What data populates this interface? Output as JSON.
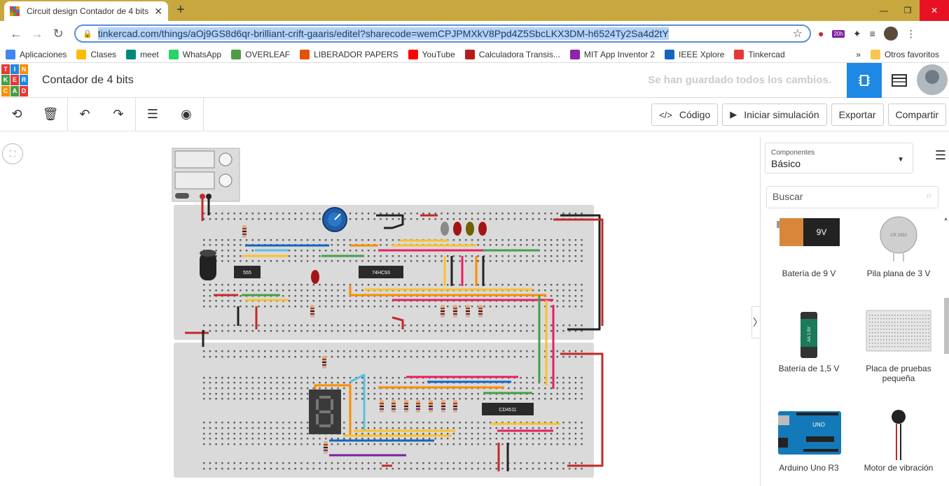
{
  "browser": {
    "tab_title": "Circuit design Contador de 4 bits",
    "url": "tinkercad.com/things/aOj9GS8d6qr-brilliant-crift-gaaris/editel?sharecode=wemCPJPMXkV8Ppd4Z5SbcLKX3DM-h6524Ty2Sa4d2tY",
    "ext_badge": "20h",
    "bookmarks": [
      {
        "label": "Aplicaciones",
        "color": "#4285f4"
      },
      {
        "label": "Clases",
        "color": "#fbbc04"
      },
      {
        "label": "meet",
        "color": "#00897b"
      },
      {
        "label": "WhatsApp",
        "color": "#25d366"
      },
      {
        "label": "OVERLEAF",
        "color": "#4f9c45"
      },
      {
        "label": "LIBERADOR PAPERS",
        "color": "#e65100"
      },
      {
        "label": "YouTube",
        "color": "#ff0000"
      },
      {
        "label": "Calculadora Transis...",
        "color": "#b71c1c"
      },
      {
        "label": "MIT App Inventor 2",
        "color": "#8e24aa"
      },
      {
        "label": "IEEE Xplore",
        "color": "#1565c0"
      },
      {
        "label": "Tinkercad",
        "color": "#e53935"
      }
    ],
    "bookmarks_more": "»",
    "other_favorites": "Otros favoritos"
  },
  "app": {
    "logo_letters": [
      "T",
      "I",
      "N",
      "K",
      "E",
      "R",
      "C",
      "A",
      "D"
    ],
    "project_title": "Contador de 4 bits",
    "save_status": "Se han guardado todos los cambios.",
    "accent": "#1e88e5"
  },
  "toolbar": {
    "code_label": "Código",
    "simulate_label": "Iniciar simulación",
    "export_label": "Exportar",
    "share_label": "Compartir"
  },
  "circuit": {
    "chip_labels": [
      "555",
      "74HC93",
      "CD4511"
    ]
  },
  "panel": {
    "components_label": "Componentes",
    "components_value": "Básico",
    "search_placeholder": "Buscar",
    "items": [
      {
        "label": "Batería de 9 V",
        "img_text": "9V"
      },
      {
        "label": "Pila plana de 3 V",
        "img_text": "CR 2032"
      },
      {
        "label": "Batería de 1,5 V",
        "img_text": "AA 1.5V"
      },
      {
        "label": "Placa de pruebas pequeña",
        "img_text": ""
      },
      {
        "label": "Arduino Uno R3",
        "img_text": "UNO"
      },
      {
        "label": "Motor de vibración",
        "img_text": ""
      }
    ]
  }
}
